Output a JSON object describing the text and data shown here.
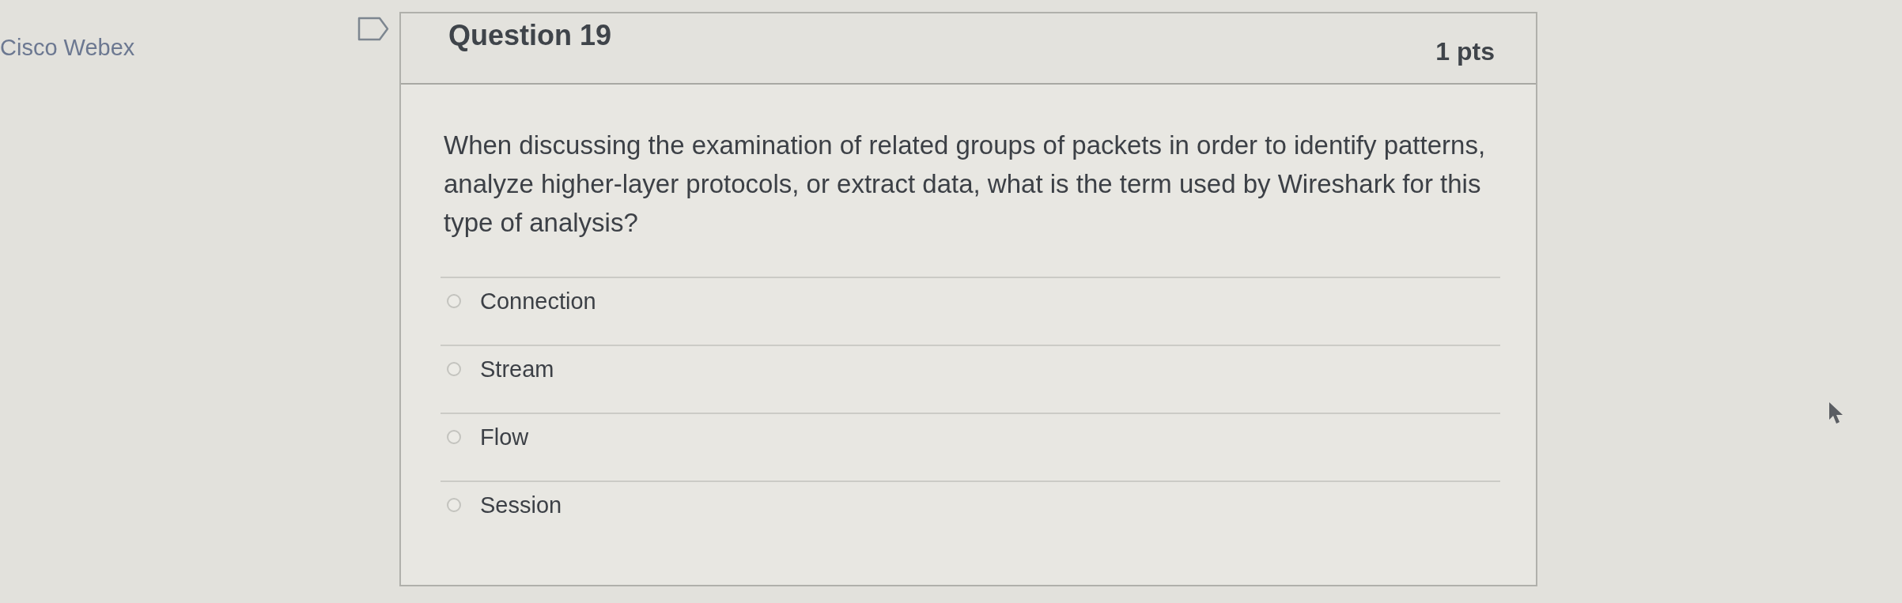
{
  "app_label": "Cisco Webex",
  "question": {
    "title": "Question 19",
    "points": "1 pts",
    "text": "When discussing the examination of related groups of packets in order to identify patterns, analyze higher-layer protocols, or extract data, what is the term used by Wireshark for this type of analysis?",
    "answers": [
      {
        "label": "Connection",
        "selected": false
      },
      {
        "label": "Stream",
        "selected": false
      },
      {
        "label": "Flow",
        "selected": false
      },
      {
        "label": "Session",
        "selected": false
      }
    ]
  }
}
